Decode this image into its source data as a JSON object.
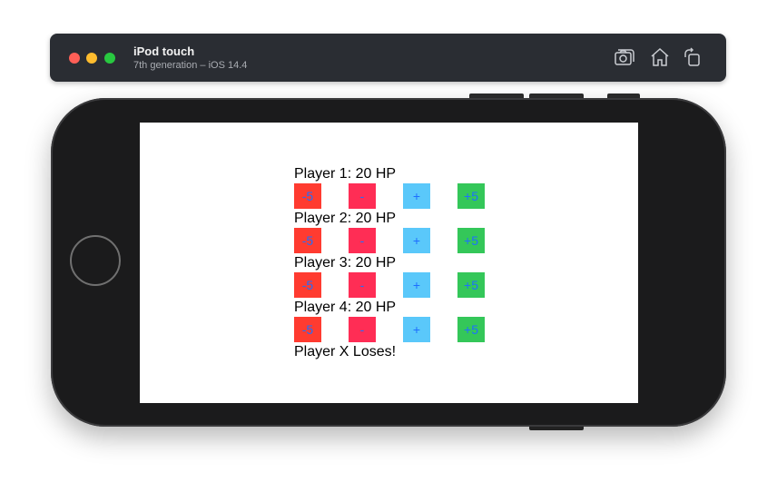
{
  "simulator": {
    "device_name": "iPod touch",
    "device_subtitle": "7th generation – iOS 14.4",
    "icons": [
      "screenshot-icon",
      "home-icon",
      "rotate-icon"
    ]
  },
  "app": {
    "players": [
      {
        "label": "Player 1: 20 HP",
        "buttons": [
          "-5",
          "-",
          "+",
          "+5"
        ]
      },
      {
        "label": "Player 2: 20 HP",
        "buttons": [
          "-5",
          "-",
          "+",
          "+5"
        ]
      },
      {
        "label": "Player 3: 20 HP",
        "buttons": [
          "-5",
          "-",
          "+",
          "+5"
        ]
      },
      {
        "label": "Player 4: 20 HP",
        "buttons": [
          "-5",
          "-",
          "+",
          "+5"
        ]
      }
    ],
    "status": "Player X Loses!"
  },
  "colors": {
    "minus_five": "#ff3b30",
    "minus": "#ff2d55",
    "plus": "#5ac8fa",
    "plus_five": "#34c759",
    "button_text": "#1e6fff"
  }
}
